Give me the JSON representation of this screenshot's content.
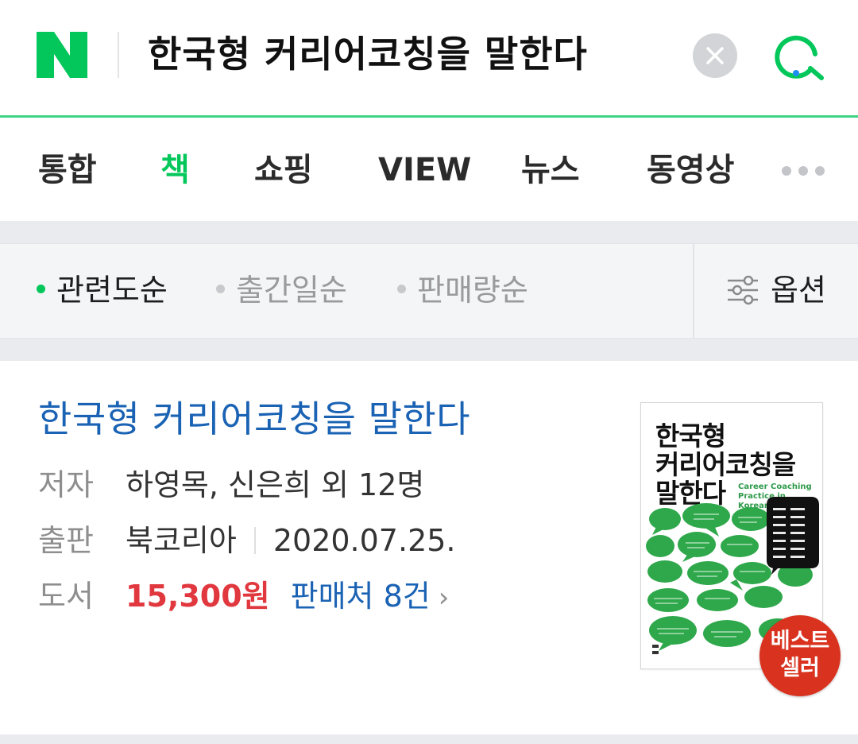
{
  "header": {
    "logo_icon": "naver-n-logo",
    "search_query": "한국형 커리어코칭을 말한다",
    "clear_icon": "clear-x-icon",
    "search_icon": "search-icon",
    "accent_color": "#03c75a"
  },
  "tabs": [
    {
      "label": "통합",
      "active": false
    },
    {
      "label": "책",
      "active": true
    },
    {
      "label": "쇼핑",
      "active": false
    },
    {
      "label": "VIEW",
      "active": false
    },
    {
      "label": "뉴스",
      "active": false
    },
    {
      "label": "동영상",
      "active": false
    }
  ],
  "sort": {
    "items": [
      {
        "label": "관련도순",
        "active": true
      },
      {
        "label": "출간일순",
        "active": false
      },
      {
        "label": "판매량순",
        "active": false
      }
    ],
    "option_label": "옵션",
    "option_icon": "sliders-icon"
  },
  "result": {
    "title": "한국형 커리어코칭을 말한다",
    "author_label": "저자",
    "author_value": "하영목, 신은희 외 12명",
    "publisher_label": "출판",
    "publisher_value": "북코리아",
    "date_value": "2020.07.25.",
    "book_label": "도서",
    "price": "15,300원",
    "sellers": "판매처 8건",
    "chevron": "›",
    "cover": {
      "title_line1": "한국형",
      "title_line2": "커리어코칭을",
      "title_line3": "말한다",
      "subtitle": "Career Coaching Practice in Korean Context"
    },
    "badge_line1": "베스트",
    "badge_line2": "셀러",
    "price_color": "#e0383e",
    "link_color": "#1a62b4"
  }
}
